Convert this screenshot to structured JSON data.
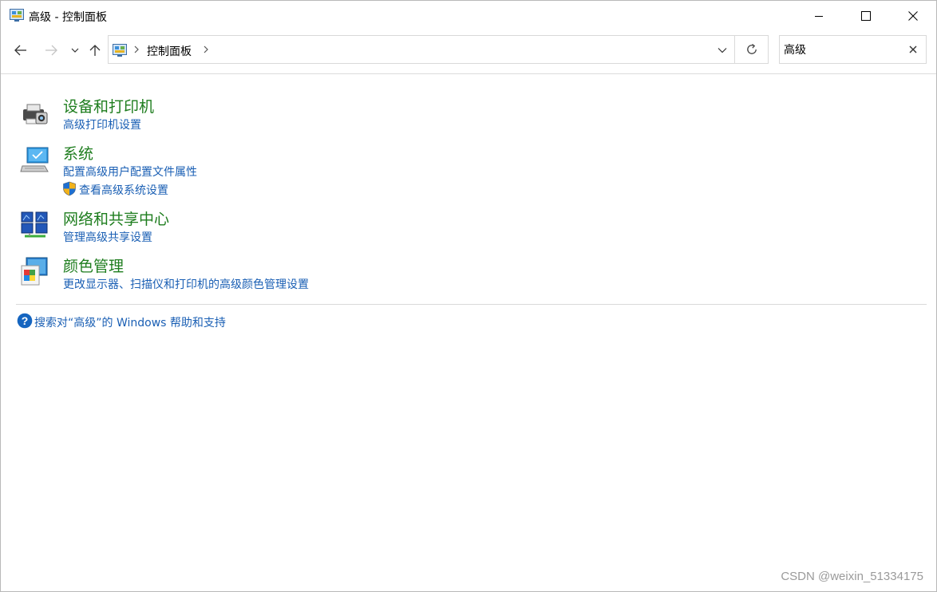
{
  "window": {
    "title": "高级 - 控制面板"
  },
  "address_bar": {
    "crumb": "控制面板"
  },
  "search": {
    "value": "高级"
  },
  "results": [
    {
      "title": "设备和打印机",
      "icon": "printer-icon",
      "links": [
        {
          "text": "高级打印机设置",
          "shield": false
        }
      ]
    },
    {
      "title": "系统",
      "icon": "computer-icon",
      "links": [
        {
          "text": "配置高级用户配置文件属性",
          "shield": false
        },
        {
          "text": "查看高级系统设置",
          "shield": true
        }
      ]
    },
    {
      "title": "网络和共享中心",
      "icon": "network-icon",
      "links": [
        {
          "text": "管理高级共享设置",
          "shield": false
        }
      ]
    },
    {
      "title": "颜色管理",
      "icon": "color-management-icon",
      "links": [
        {
          "text": "更改显示器、扫描仪和打印机的高级颜色管理设置",
          "shield": false
        }
      ]
    }
  ],
  "help": {
    "text": "搜索对“高级”的 Windows 帮助和支持"
  },
  "watermark": "CSDN @weixin_51334175",
  "colors": {
    "category_title": "#1e7d1e",
    "link": "#1a5fb4",
    "help_icon": "#1565c0"
  }
}
